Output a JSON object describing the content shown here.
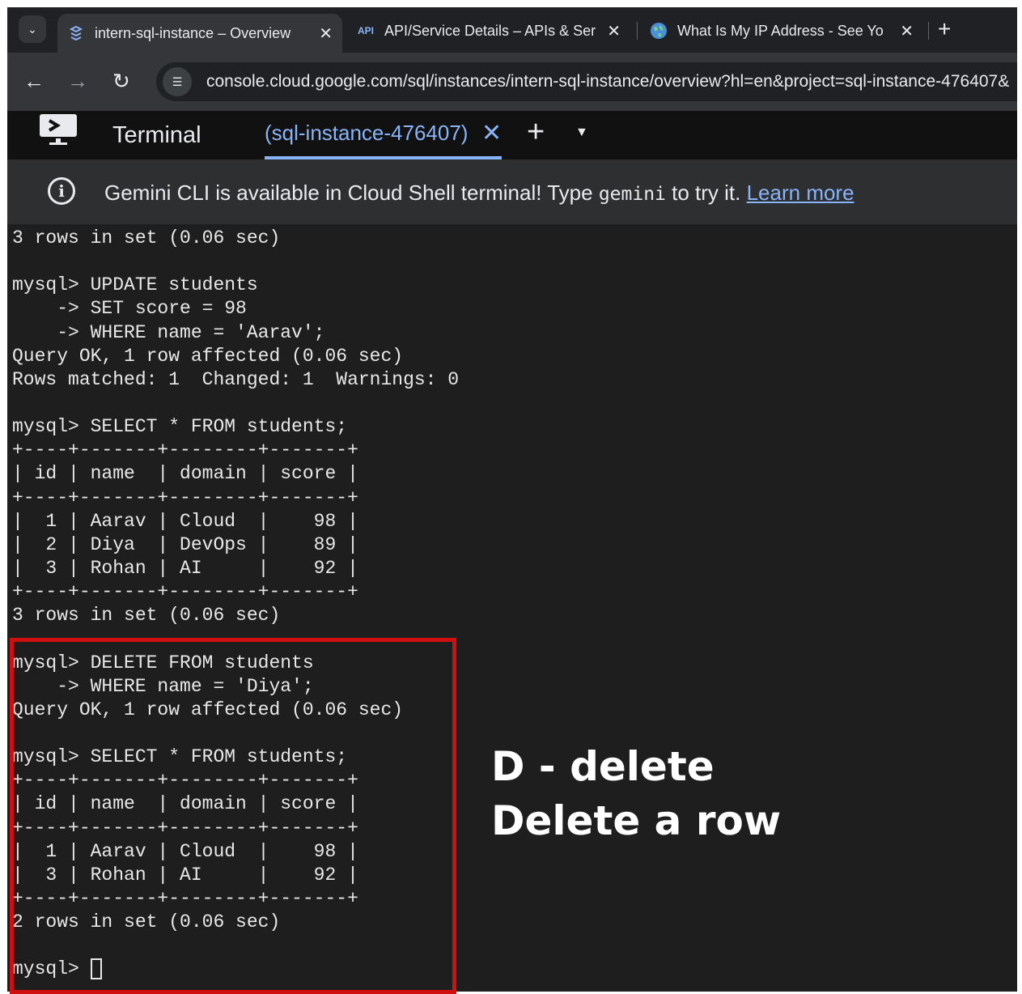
{
  "browser": {
    "tabs": [
      {
        "title": "intern-sql-instance – Overview",
        "favicon": "cloud-sql-icon",
        "active": true
      },
      {
        "title": "API/Service Details – APIs & Ser",
        "favicon_text": "API",
        "active": false
      },
      {
        "title": "What Is My IP Address - See Yo",
        "favicon": "globe-icon",
        "active": false
      }
    ],
    "url": "console.cloud.google.com/sql/instances/intern-sql-instance/overview?hl=en&project=sql-instance-476407&"
  },
  "shell": {
    "title": "Terminal",
    "tab_label": "(sql-instance-476407)"
  },
  "banner": {
    "text_before": "Gemini CLI is available in Cloud Shell terminal! Type ",
    "code": "gemini",
    "text_after": " to try it. ",
    "link": "Learn more"
  },
  "terminal": {
    "lines": [
      "3 rows in set (0.06 sec)",
      "",
      "mysql> UPDATE students",
      "    -> SET score = 98",
      "    -> WHERE name = 'Aarav';",
      "Query OK, 1 row affected (0.06 sec)",
      "Rows matched: 1  Changed: 1  Warnings: 0",
      "",
      "mysql> SELECT * FROM students;",
      "+----+-------+--------+-------+",
      "| id | name  | domain | score |",
      "+----+-------+--------+-------+",
      "|  1 | Aarav | Cloud  |    98 |",
      "|  2 | Diya  | DevOps |    89 |",
      "|  3 | Rohan | AI     |    92 |",
      "+----+-------+--------+-------+",
      "3 rows in set (0.06 sec)",
      "",
      "mysql> DELETE FROM students",
      "    -> WHERE name = 'Diya';",
      "Query OK, 1 row affected (0.06 sec)",
      "",
      "mysql> SELECT * FROM students;",
      "+----+-------+--------+-------+",
      "| id | name  | domain | score |",
      "+----+-------+--------+-------+",
      "|  1 | Aarav | Cloud  |    98 |",
      "|  3 | Rohan | AI     |    92 |",
      "+----+-------+--------+-------+",
      "2 rows in set (0.06 sec)",
      ""
    ],
    "prompt": "mysql> "
  },
  "annotation": {
    "line1": "D - delete",
    "line2": "Delete a row",
    "box_color": "#d10f0f"
  }
}
